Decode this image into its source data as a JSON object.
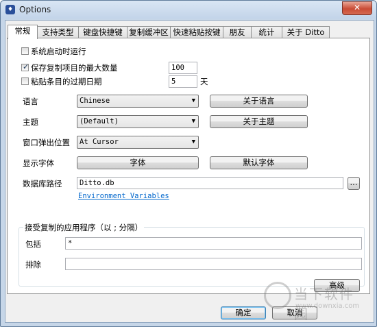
{
  "window": {
    "title": "Options",
    "close_glyph": "✕",
    "icon": "ditto-app-icon"
  },
  "tabs": [
    {
      "label": "常规",
      "active": true
    },
    {
      "label": "支持类型",
      "active": false
    },
    {
      "label": "键盘快捷键",
      "active": false
    },
    {
      "label": "复制缓冲区",
      "active": false
    },
    {
      "label": "快速粘贴按键",
      "active": false
    },
    {
      "label": "朋友",
      "active": false
    },
    {
      "label": "统计",
      "active": false
    },
    {
      "label": "关于 Ditto",
      "active": false
    }
  ],
  "general": {
    "start_on_boot": {
      "label": "系统启动时运行",
      "checked": false
    },
    "max_copies": {
      "label": "保存复制项目的最大数量",
      "checked": true,
      "value": "100"
    },
    "expire": {
      "label": "粘贴条目的过期日期",
      "checked": false,
      "value": "5",
      "unit": "天"
    },
    "language": {
      "label": "语言",
      "value": "Chinese",
      "button": "关于语言"
    },
    "theme": {
      "label": "主题",
      "value": "(Default)",
      "button": "关于主题"
    },
    "popup_position": {
      "label": "窗口弹出位置",
      "value": "At Cursor"
    },
    "display_font": {
      "label": "显示字体",
      "font_button": "字体",
      "default_font_button": "默认字体"
    },
    "db_path": {
      "label": "数据库路径",
      "value": "Ditto.db",
      "browse": "...",
      "env_link": "Environment Variables"
    },
    "accepted_apps": {
      "title": "接受复制的应用程序（以 ; 分隔）",
      "include": {
        "label": "包括",
        "value": "*"
      },
      "exclude": {
        "label": "排除",
        "value": ""
      }
    },
    "advanced_button": "高级"
  },
  "footer": {
    "ok": "确定",
    "cancel": "取消"
  },
  "watermark": {
    "text": "当下软件园",
    "url": "www.downxia.com"
  },
  "colors": {
    "accent": "#3c7fb1",
    "link": "#0066cc",
    "close": "#c94c36"
  }
}
